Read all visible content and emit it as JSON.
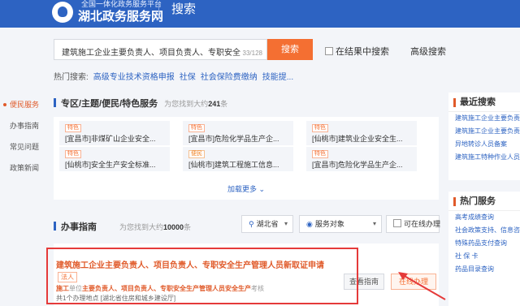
{
  "header": {
    "logo_sub": "全国一体化政务服务平台",
    "logo_title": "湖北政务服务网",
    "page_title": "搜索"
  },
  "search": {
    "value": "建筑施工企业主要负责人、项目负责人、专职安全",
    "count": "33/128",
    "button": "搜索",
    "in_result": "在结果中搜索",
    "advanced": "高级搜索"
  },
  "hot": {
    "label": "热门搜索:",
    "items": [
      "高级专业技术资格申报",
      "社保",
      "社会保险费缴纳",
      "技能提..."
    ]
  },
  "leftnav": [
    "便民服务",
    "办事指南",
    "常见问题",
    "政策新闻"
  ],
  "special": {
    "title": "专区/主题/便民/特色服务",
    "count_prefix": "为您找到大约",
    "count": "241",
    "count_suffix": "条",
    "cards": [
      {
        "tag": "特色",
        "name": "[宜昌市]非煤矿山企业安全..."
      },
      {
        "tag": "特色",
        "name": "[宜昌市]危险化学品生产企..."
      },
      {
        "tag": "特色",
        "name": "[仙桃市]建筑业企业安全生..."
      },
      {
        "tag": "特色",
        "name": "[仙桃市]安全生产安全标准..."
      },
      {
        "tag": "便民",
        "name": "[仙桃市]建筑工程施工信息..."
      },
      {
        "tag": "特色",
        "name": "[宜昌市]危险化学品生产企..."
      }
    ],
    "more": "加载更多 ⌄"
  },
  "guide": {
    "title": "办事指南",
    "count_prefix": "为您找到大约",
    "count": "10000",
    "count_suffix": "条",
    "filters": {
      "region": "湖北省",
      "target": "服务对象",
      "online": "可在线办理"
    }
  },
  "result": {
    "title": "建筑施工企业主要负责人、项目负责人、专职安全生产管理人员新取证申请",
    "tag": "法人",
    "desc_prefix": "施工",
    "desc_hl1": "单位",
    "desc_mid": "主要负责人、项目负责人、专职安全生产管理人员",
    "desc_hl2": "安全生产",
    "desc_suffix": "考核",
    "meta": "共1个办理地点 [湖北省住房和城乡建设厅]",
    "btn_guide": "查看指南",
    "btn_online": "在线办理"
  },
  "sidebar": {
    "recent_title": "最近搜索",
    "recent": [
      "建筑施工企业主要负责...",
      "建筑施工企业主要负责...",
      "异地转诊人员备案",
      "建筑施工特种作业人员..."
    ],
    "hot_title": "热门服务",
    "hot": [
      "高考成绩查询",
      "社会政策支持、信息咨询",
      "特殊药品支付查询",
      "社 保 卡",
      "药品目录查询"
    ]
  },
  "colors": {
    "brand": "#2d63c2",
    "accent": "#f46f32",
    "highlight": "#e53a3a"
  }
}
